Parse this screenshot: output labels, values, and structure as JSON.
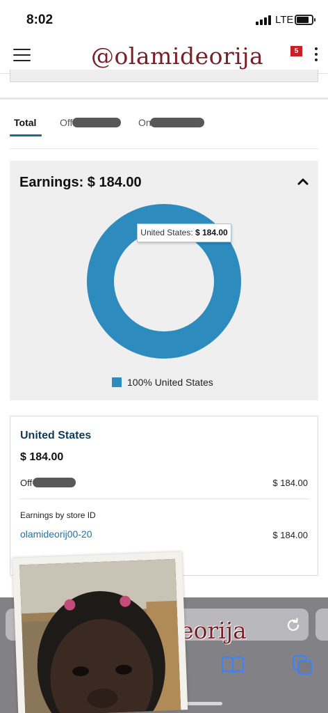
{
  "status_bar": {
    "time": "8:02",
    "network": "LTE"
  },
  "header": {
    "watermark": "@olamideorija",
    "notification_count": "5"
  },
  "tabs": [
    {
      "label": "Total",
      "active": true
    },
    {
      "label": "Off",
      "active": false
    },
    {
      "label": "On",
      "active": false
    }
  ],
  "earnings": {
    "title": "Earnings: $ 184.00",
    "tooltip_country": "United States:",
    "tooltip_amount": "$ 184.00",
    "legend": "100% United States",
    "color": "#2e8bbe"
  },
  "chart_data": {
    "type": "pie",
    "categories": [
      "United States"
    ],
    "values": [
      184.0
    ],
    "title": "Earnings: $ 184.00"
  },
  "country_detail": {
    "name": "United States",
    "total": "$ 184.00",
    "row_label": "Off",
    "row_value": "$ 184.00",
    "store_heading": "Earnings by store ID",
    "store_id": "olamideorij00-20",
    "store_value": "$ 184.00"
  },
  "browser": {
    "url_watermark": "deorija"
  }
}
